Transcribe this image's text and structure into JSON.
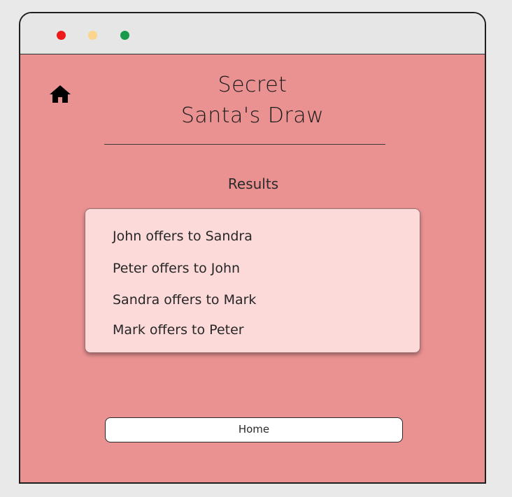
{
  "window": {
    "controls": [
      {
        "name": "close",
        "color": "#ee1a1a"
      },
      {
        "name": "minimize",
        "color": "#fbd58e"
      },
      {
        "name": "maximize",
        "color": "#1a9a4c"
      }
    ]
  },
  "page": {
    "background_color": "#ea9291",
    "home_icon": "home-icon",
    "title_line1": "Secret",
    "title_line2": "Santa's Draw",
    "results_label": "Results",
    "results": [
      "John offers to Sandra",
      "Peter offers to John",
      "Sandra offers to Mark",
      "Mark offers to Peter"
    ],
    "home_button_label": "Home"
  }
}
